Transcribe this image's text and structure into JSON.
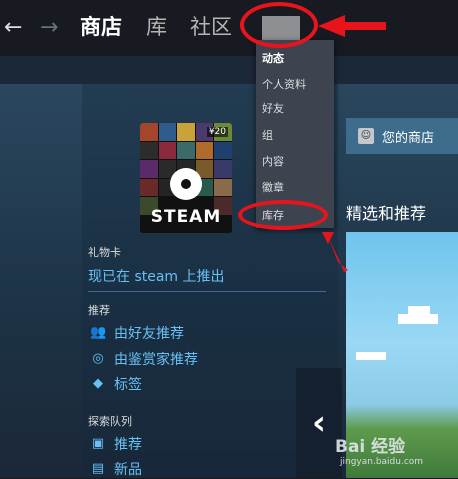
{
  "topbar": {
    "back_icon": "arrow-left-icon",
    "forward_icon": "arrow-right-icon",
    "back_glyph": "←",
    "forward_glyph": "→",
    "tabs": [
      {
        "label": "商店",
        "active": true
      },
      {
        "label": "库",
        "active": false
      },
      {
        "label": "社区",
        "active": false
      }
    ]
  },
  "dropdown": {
    "items": [
      "动态",
      "个人资料",
      "好友",
      "组",
      "内容",
      "徽章",
      "库存"
    ]
  },
  "gift_card": {
    "brand": "STEAM",
    "price_badge": "¥20"
  },
  "left_panel": {
    "gift_section": {
      "heading": "礼物卡",
      "link": "现已在 steam 上推出"
    },
    "recommend_section": {
      "heading": "推荐",
      "items": [
        {
          "label": "由好友推荐",
          "icon": "friends-icon"
        },
        {
          "label": "由鉴赏家推荐",
          "icon": "curator-icon"
        },
        {
          "label": "标签",
          "icon": "tag-icon"
        }
      ]
    },
    "queue_section": {
      "heading": "探索队列",
      "items": [
        {
          "label": "推荐",
          "icon": "queue-icon"
        },
        {
          "label": "新品",
          "icon": "new-icon"
        }
      ]
    }
  },
  "your_store": {
    "label": "您的商店"
  },
  "featured": {
    "title": "精选和推荐"
  },
  "carousel": {
    "prev_glyph": "‹"
  },
  "watermark": {
    "text": "Bai 经验",
    "sub": "jingyan.baidu.com"
  },
  "colors": {
    "annotation": "#e8141b",
    "link": "#67c1f5",
    "topbar": "#171a21",
    "dropdown": "#3d4450"
  }
}
